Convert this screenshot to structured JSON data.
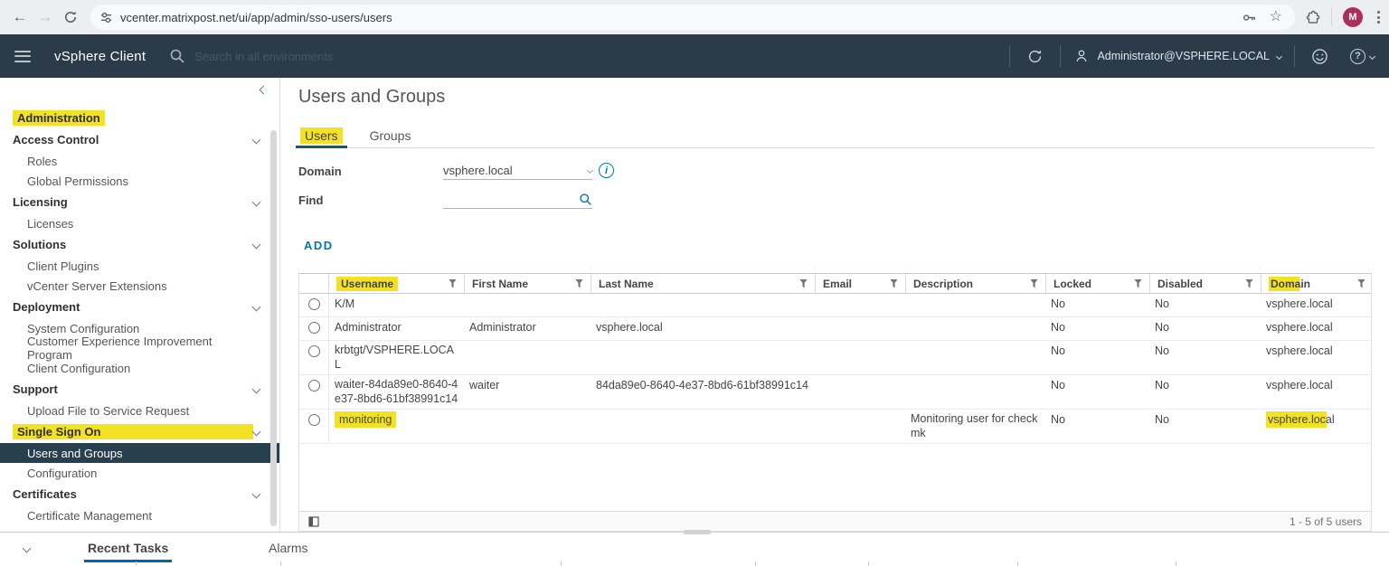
{
  "browser": {
    "url": "vcenter.matrixpost.net/ui/app/admin/sso-users/users",
    "avatar_letter": "M"
  },
  "app_header": {
    "title": "vSphere Client",
    "search_placeholder": "Search in all environments",
    "user_menu": "Administrator@VSPHERE.LOCAL"
  },
  "sidebar": {
    "items": [
      {
        "label": "Administration",
        "type": "root",
        "highlight": true
      },
      {
        "label": "Access Control",
        "type": "section",
        "chevron": true
      },
      {
        "label": "Roles",
        "type": "child"
      },
      {
        "label": "Global Permissions",
        "type": "child"
      },
      {
        "label": "Licensing",
        "type": "section",
        "chevron": true
      },
      {
        "label": "Licenses",
        "type": "child"
      },
      {
        "label": "Solutions",
        "type": "section",
        "chevron": true
      },
      {
        "label": "Client Plugins",
        "type": "child"
      },
      {
        "label": "vCenter Server Extensions",
        "type": "child"
      },
      {
        "label": "Deployment",
        "type": "section",
        "chevron": true
      },
      {
        "label": "System Configuration",
        "type": "child"
      },
      {
        "label": "Customer Experience Improvement Program",
        "type": "child"
      },
      {
        "label": "Client Configuration",
        "type": "child"
      },
      {
        "label": "Support",
        "type": "section",
        "chevron": true
      },
      {
        "label": "Upload File to Service Request",
        "type": "child"
      },
      {
        "label": "Single Sign On",
        "type": "section",
        "chevron": true,
        "highlight": true
      },
      {
        "label": "Users and Groups",
        "type": "child",
        "selected": true
      },
      {
        "label": "Configuration",
        "type": "child"
      },
      {
        "label": "Certificates",
        "type": "section",
        "chevron": true
      },
      {
        "label": "Certificate Management",
        "type": "child"
      }
    ]
  },
  "content": {
    "page_title": "Users and Groups",
    "tabs": [
      {
        "label": "Users",
        "active": true,
        "highlight": true
      },
      {
        "label": "Groups",
        "active": false
      }
    ],
    "form": {
      "domain_label": "Domain",
      "domain_value": "vsphere.local",
      "find_label": "Find",
      "find_value": ""
    },
    "add_button": "ADD",
    "table": {
      "columns": [
        {
          "label": ""
        },
        {
          "label": "Username",
          "highlight": "full"
        },
        {
          "label": "First Name"
        },
        {
          "label": "Last Name"
        },
        {
          "label": "Email"
        },
        {
          "label": "Description"
        },
        {
          "label": "Locked"
        },
        {
          "label": "Disabled"
        },
        {
          "label": "Domain",
          "highlight": "partial"
        }
      ],
      "rows": [
        {
          "username": "K/M",
          "first_name": "",
          "last_name": "",
          "email": "",
          "description": "",
          "locked": "No",
          "disabled": "No",
          "domain": "vsphere.local"
        },
        {
          "username": "Administrator",
          "first_name": "Administrator",
          "last_name": "vsphere.local",
          "email": "",
          "description": "",
          "locked": "No",
          "disabled": "No",
          "domain": "vsphere.local"
        },
        {
          "username": "krbtgt/VSPHERE.LOCAL",
          "first_name": "",
          "last_name": "",
          "email": "",
          "description": "",
          "locked": "No",
          "disabled": "No",
          "domain": "vsphere.local"
        },
        {
          "username": "waiter-84da89e0-8640-4e37-8bd6-61bf38991c14",
          "first_name": "waiter",
          "last_name": "84da89e0-8640-4e37-8bd6-61bf38991c14",
          "email": "",
          "description": "",
          "locked": "No",
          "disabled": "No",
          "domain": "vsphere.local"
        },
        {
          "username": "monitoring",
          "username_highlight": true,
          "first_name": "",
          "last_name": "",
          "email": "",
          "description": "Monitoring user for checkmk",
          "locked": "No",
          "disabled": "No",
          "domain": "vsphere.local",
          "domain_highlight": true
        }
      ],
      "footer_count": "1 - 5 of 5 users"
    }
  },
  "bottom_bar": {
    "tabs": [
      "Recent Tasks",
      "Alarms"
    ]
  },
  "colors": {
    "accent_blue": "#0079ad",
    "highlight_yellow": "#f3e125",
    "header_bg": "#2b3b49",
    "selected_nav_bg": "#28404e",
    "task_underline": "#0065ab",
    "tab_underline": "#0b5d78"
  }
}
